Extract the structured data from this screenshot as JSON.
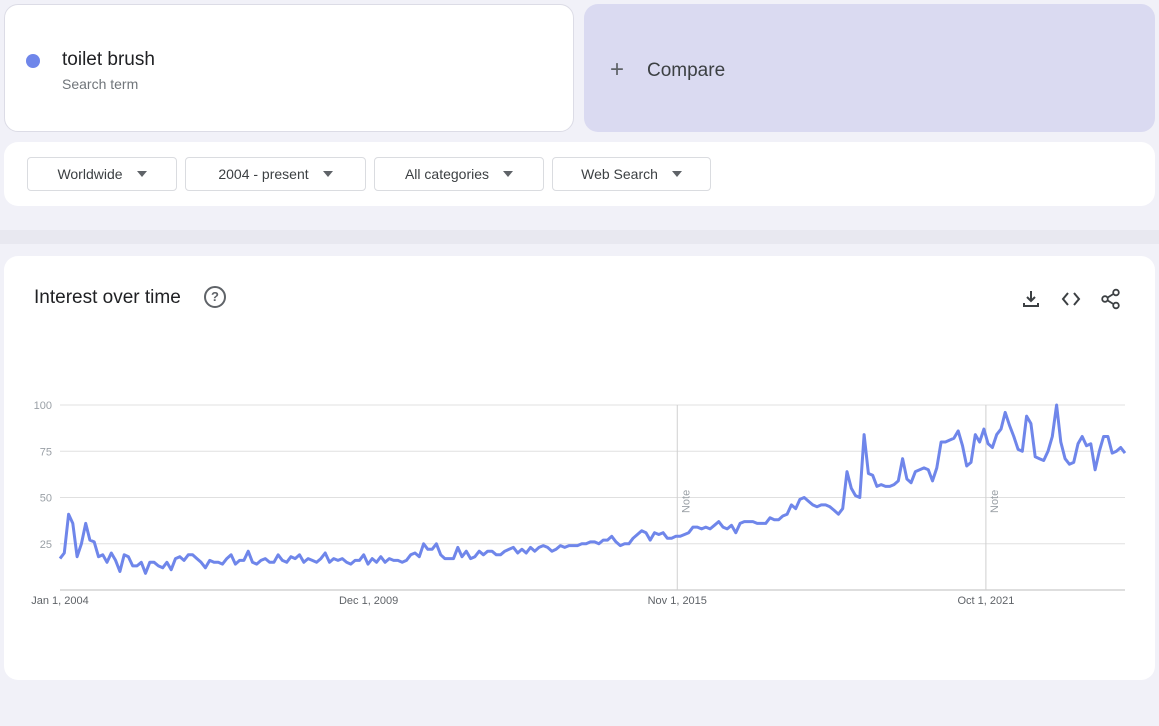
{
  "search_term": {
    "name": "toilet brush",
    "subtitle": "Search term",
    "color": "#6f86ea"
  },
  "compare": {
    "plus": "+",
    "label": "Compare"
  },
  "filters": [
    {
      "label": "Worldwide"
    },
    {
      "label": "2004 - present"
    },
    {
      "label": "All categories"
    },
    {
      "label": "Web Search"
    }
  ],
  "panel": {
    "title": "Interest over time",
    "icons": [
      "help-icon",
      "download-icon",
      "embed-icon",
      "share-icon"
    ]
  },
  "chart_data": {
    "type": "line",
    "title": "Interest over time",
    "ylim": [
      0,
      100
    ],
    "yticks": [
      25,
      50,
      75,
      100
    ],
    "grid": true,
    "color": "#6f86ea",
    "x_start": "Jan 1, 2004",
    "x_end": "Jun 1, 2024",
    "xtick_labels": [
      {
        "date": "2004-01-01",
        "label": "Jan 1, 2004"
      },
      {
        "date": "2009-12-01",
        "label": "Dec 1, 2009"
      },
      {
        "date": "2015-11-01",
        "label": "Nov 1, 2015"
      },
      {
        "date": "2021-10-01",
        "label": "Oct 1, 2021"
      }
    ],
    "notes": [
      {
        "date": "2015-11-01",
        "label": "Note"
      },
      {
        "date": "2021-10-01",
        "label": "Note"
      }
    ],
    "series": [
      {
        "values": [
          17,
          20,
          41,
          36,
          18,
          25,
          36,
          27,
          26,
          18,
          19,
          15,
          20,
          16,
          10,
          19,
          18,
          13,
          13,
          15,
          9,
          15,
          15,
          13,
          12,
          15,
          11,
          17,
          18,
          16,
          19,
          19,
          17,
          15,
          12,
          16,
          15,
          15,
          14,
          17,
          19,
          14,
          16,
          16,
          21,
          15,
          14,
          16,
          17,
          15,
          15,
          19,
          16,
          15,
          18,
          17,
          19,
          15,
          17,
          16,
          15,
          17,
          20,
          15,
          17,
          16,
          17,
          15,
          14,
          16,
          16,
          19,
          14,
          17,
          15,
          18,
          15,
          17,
          16,
          16,
          15,
          16,
          19,
          20,
          18,
          25,
          22,
          22,
          25,
          19,
          17,
          17,
          17,
          23,
          18,
          21,
          17,
          18,
          21,
          19,
          21,
          21,
          19,
          19,
          21,
          22,
          23,
          20,
          22,
          20,
          23,
          21,
          23,
          24,
          23,
          21,
          22,
          24,
          23,
          24,
          24,
          24,
          25,
          25,
          26,
          26,
          25,
          27,
          27,
          29,
          26,
          24,
          25,
          25,
          28,
          30,
          32,
          31,
          27,
          31,
          30,
          31,
          28,
          28,
          29,
          29,
          30,
          31,
          34,
          34,
          33,
          34,
          33,
          35,
          37,
          34,
          33,
          35,
          31,
          36,
          37,
          37,
          37,
          36,
          36,
          36,
          39,
          38,
          38,
          40,
          41,
          46,
          44,
          49,
          50,
          48,
          46,
          45,
          46,
          46,
          45,
          43,
          41,
          44,
          64,
          55,
          51,
          50,
          84,
          63,
          62,
          56,
          57,
          56,
          56,
          57,
          59,
          71,
          60,
          58,
          64,
          65,
          66,
          65,
          59,
          66,
          80,
          80,
          81,
          82,
          86,
          78,
          67,
          69,
          84,
          80,
          87,
          79,
          77,
          84,
          87,
          96,
          89,
          83,
          76,
          75,
          94,
          90,
          72,
          71,
          70,
          75,
          83,
          100,
          80,
          71,
          68,
          69,
          79,
          83,
          78,
          79,
          65,
          75,
          83,
          83,
          74,
          75,
          77,
          74
        ]
      }
    ]
  }
}
